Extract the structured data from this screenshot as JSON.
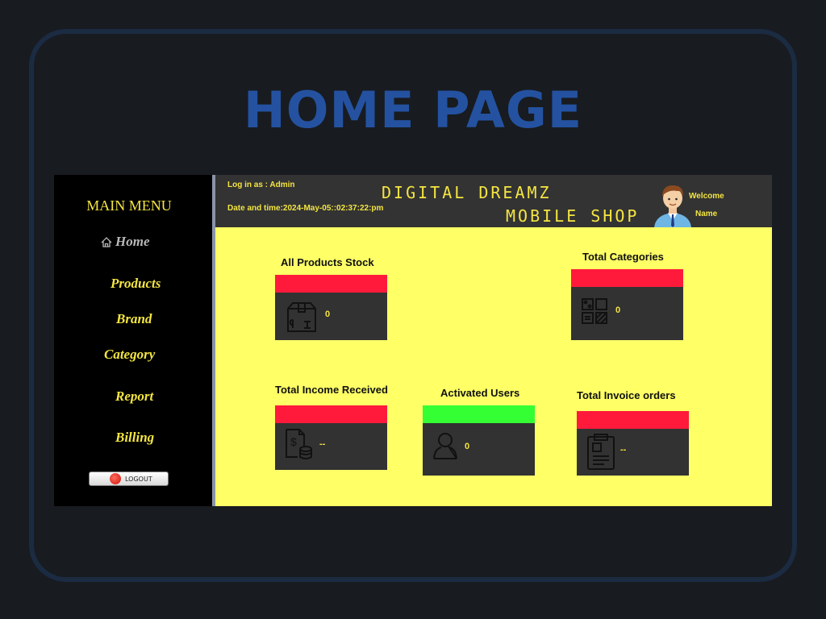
{
  "page": {
    "heading": "HOME PAGE"
  },
  "sidebar": {
    "title": "MAIN MENU",
    "items": [
      {
        "label": "Home",
        "icon": "home-icon"
      },
      {
        "label": "Products"
      },
      {
        "label": "Brand"
      },
      {
        "label": "Category"
      },
      {
        "label": "Report"
      },
      {
        "label": "Billing"
      }
    ],
    "logout_label": "LOGOUT"
  },
  "header": {
    "login": "Log in as : Admin",
    "datetime": "Date and time:2024-May-05::02:37:22:pm",
    "brand_line1": "DIGITAL DREAMZ",
    "brand_line2": "MOBILE SHOP",
    "welcome": "Welcome",
    "name": "Name",
    "avatar_icon": "user-avatar-icon"
  },
  "cards": [
    {
      "title": "All Products Stock",
      "value": "0",
      "bar_color": "#ff1a3c",
      "icon": "box-icon"
    },
    {
      "title": "Total Categories",
      "value": "0",
      "bar_color": "#ff1a3c",
      "icon": "categories-icon"
    },
    {
      "title": "Total Income Received",
      "value": "--",
      "bar_color": "#ff1a3c",
      "icon": "income-icon"
    },
    {
      "title": "Activated Users",
      "value": "0",
      "bar_color": "#33ff33",
      "icon": "user-icon"
    },
    {
      "title": "Total Invoice orders",
      "value": "--",
      "bar_color": "#ff1a3c",
      "icon": "invoice-icon"
    }
  ],
  "colors": {
    "accent_yellow": "#f4e542",
    "content_bg": "#ffff66",
    "heading_blue": "#2452a0"
  }
}
